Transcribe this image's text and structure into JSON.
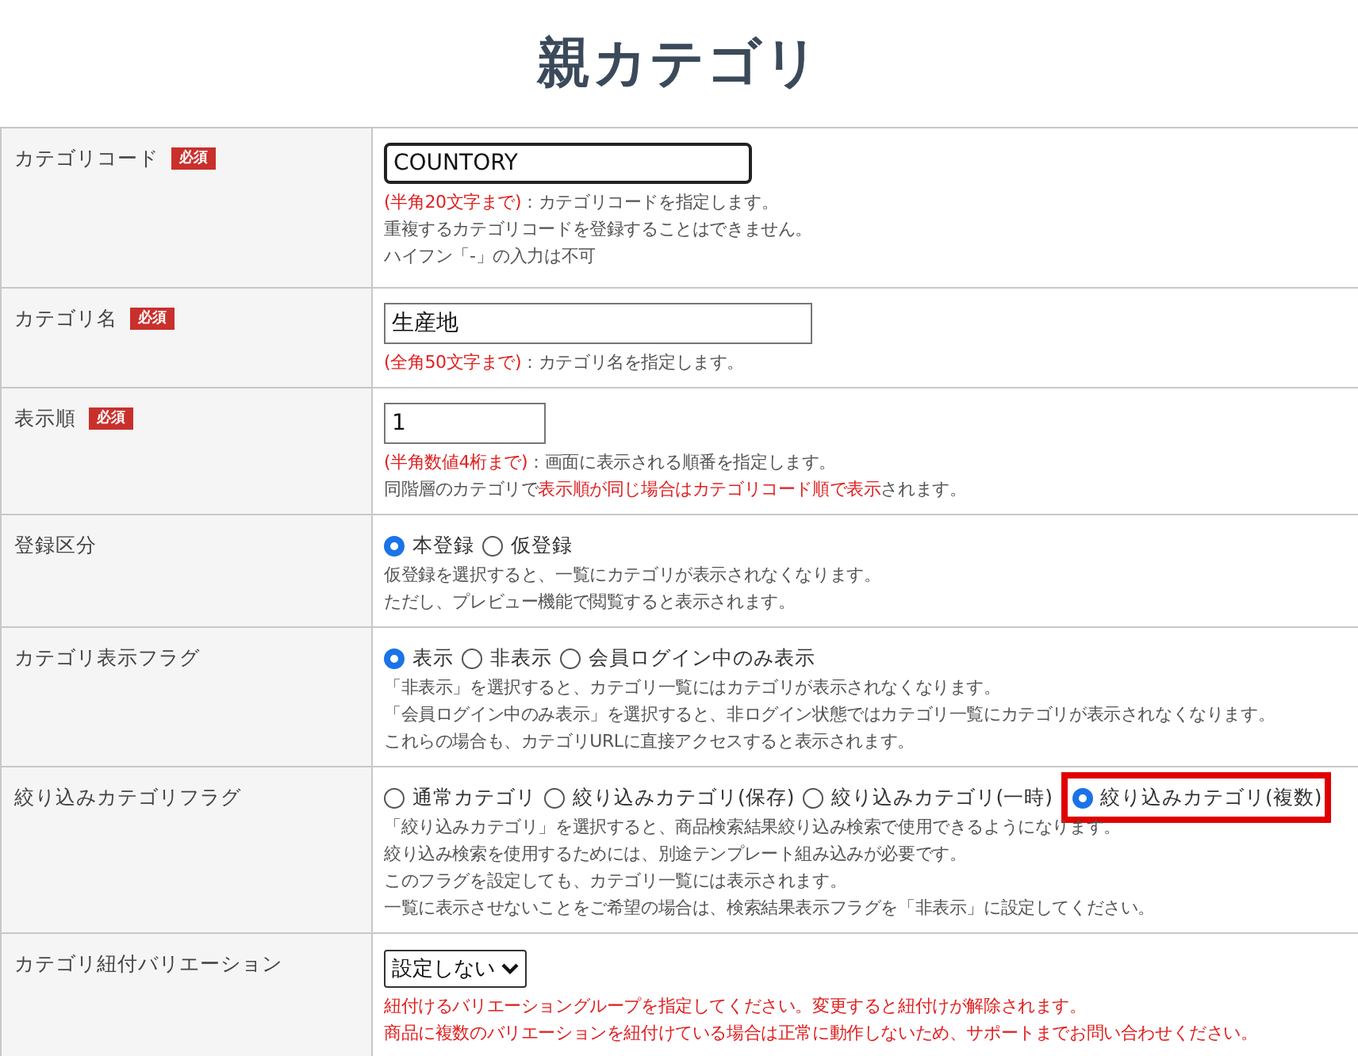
{
  "title": "親カテゴリ",
  "rows": [
    {
      "label": "カテゴリコード",
      "required": true,
      "required_badge": "必須",
      "kind": "text",
      "field": {
        "value": "COUNTORY",
        "focused": true
      },
      "notes": [
        [
          {
            "text": "(半角20文字まで)",
            "red": true
          },
          {
            "text": "：カテゴリコードを指定します。",
            "red": false
          }
        ],
        [
          {
            "text": "重複するカテゴリコードを登録することはできません。",
            "red": false
          }
        ],
        [
          {
            "text": "ハイフン「-」の入力は不可",
            "red": false
          }
        ]
      ]
    },
    {
      "label": "カテゴリ名",
      "required": true,
      "required_badge": "必須",
      "kind": "text",
      "field": {
        "value": "生産地",
        "focused": false
      },
      "notes": [
        [
          {
            "text": "(全角50文字まで)",
            "red": true
          },
          {
            "text": "：カテゴリ名を指定します。",
            "red": false
          }
        ]
      ]
    },
    {
      "label": "表示順",
      "required": true,
      "required_badge": "必須",
      "kind": "text",
      "field": {
        "value": "1",
        "focused": false
      },
      "notes": [
        [
          {
            "text": "(半角数値4桁まで)",
            "red": true
          },
          {
            "text": "：画面に表示される順番を指定します。",
            "red": false
          }
        ],
        [
          {
            "text": "同階層のカテゴリで",
            "red": false
          },
          {
            "text": "表示順が同じ場合はカテゴリコード順で表示",
            "red": true
          },
          {
            "text": "されます。",
            "red": false
          }
        ]
      ]
    },
    {
      "label": "登録区分",
      "required": false,
      "kind": "radio",
      "options": [
        {
          "label": "本登録",
          "selected": true,
          "highlighted": false
        },
        {
          "label": "仮登録",
          "selected": false,
          "highlighted": false
        }
      ],
      "notes": [
        [
          {
            "text": "仮登録を選択すると、一覧にカテゴリが表示されなくなります。",
            "red": false
          }
        ],
        [
          {
            "text": "ただし、プレビュー機能で閲覧すると表示されます。",
            "red": false
          }
        ]
      ]
    },
    {
      "label": "カテゴリ表示フラグ",
      "required": false,
      "kind": "radio",
      "options": [
        {
          "label": "表示",
          "selected": true,
          "highlighted": false
        },
        {
          "label": "非表示",
          "selected": false,
          "highlighted": false
        },
        {
          "label": "会員ログイン中のみ表示",
          "selected": false,
          "highlighted": false
        }
      ],
      "notes": [
        [
          {
            "text": "「非表示」を選択すると、カテゴリ一覧にはカテゴリが表示されなくなります。",
            "red": false
          }
        ],
        [
          {
            "text": "「会員ログイン中のみ表示」を選択すると、非ログイン状態ではカテゴリ一覧にカテゴリが表示されなくなります。",
            "red": false
          }
        ],
        [
          {
            "text": "これらの場合も、カテゴリURLに直接アクセスすると表示されます。",
            "red": false
          }
        ]
      ]
    },
    {
      "label": "絞り込みカテゴリフラグ",
      "required": false,
      "kind": "radio",
      "options": [
        {
          "label": "通常カテゴリ",
          "selected": false,
          "highlighted": false
        },
        {
          "label": "絞り込みカテゴリ(保存)",
          "selected": false,
          "highlighted": false
        },
        {
          "label": "絞り込みカテゴリ(一時)",
          "selected": false,
          "highlighted": false
        },
        {
          "label": "絞り込みカテゴリ(複数)",
          "selected": true,
          "highlighted": true
        }
      ],
      "notes": [
        [
          {
            "text": "「絞り込みカテゴリ」を選択すると、商品検索結果絞り込み検索で使用できるようになります。",
            "red": false
          }
        ],
        [
          {
            "text": "絞り込み検索を使用するためには、別途テンプレート組み込みが必要です。",
            "red": false
          }
        ],
        [
          {
            "text": "このフラグを設定しても、カテゴリ一覧には表示されます。",
            "red": false
          }
        ],
        [
          {
            "text": "一覧に表示させないことをご希望の場合は、検索結果表示フラグを「非表示」に設定してください。",
            "red": false
          }
        ]
      ]
    },
    {
      "label": "カテゴリ紐付バリエーション",
      "required": false,
      "kind": "select",
      "field": {
        "value": "設定しない"
      },
      "notes": [
        [
          {
            "text": "紐付けるバリエーショングループを指定してください。変更すると紐付けが解除されます。",
            "red": true
          }
        ],
        [
          {
            "text": "商品に複数のバリエーションを紐付けている場合は正常に動作しないため、サポートまでお問い合わせください。",
            "red": true
          }
        ]
      ]
    }
  ]
}
